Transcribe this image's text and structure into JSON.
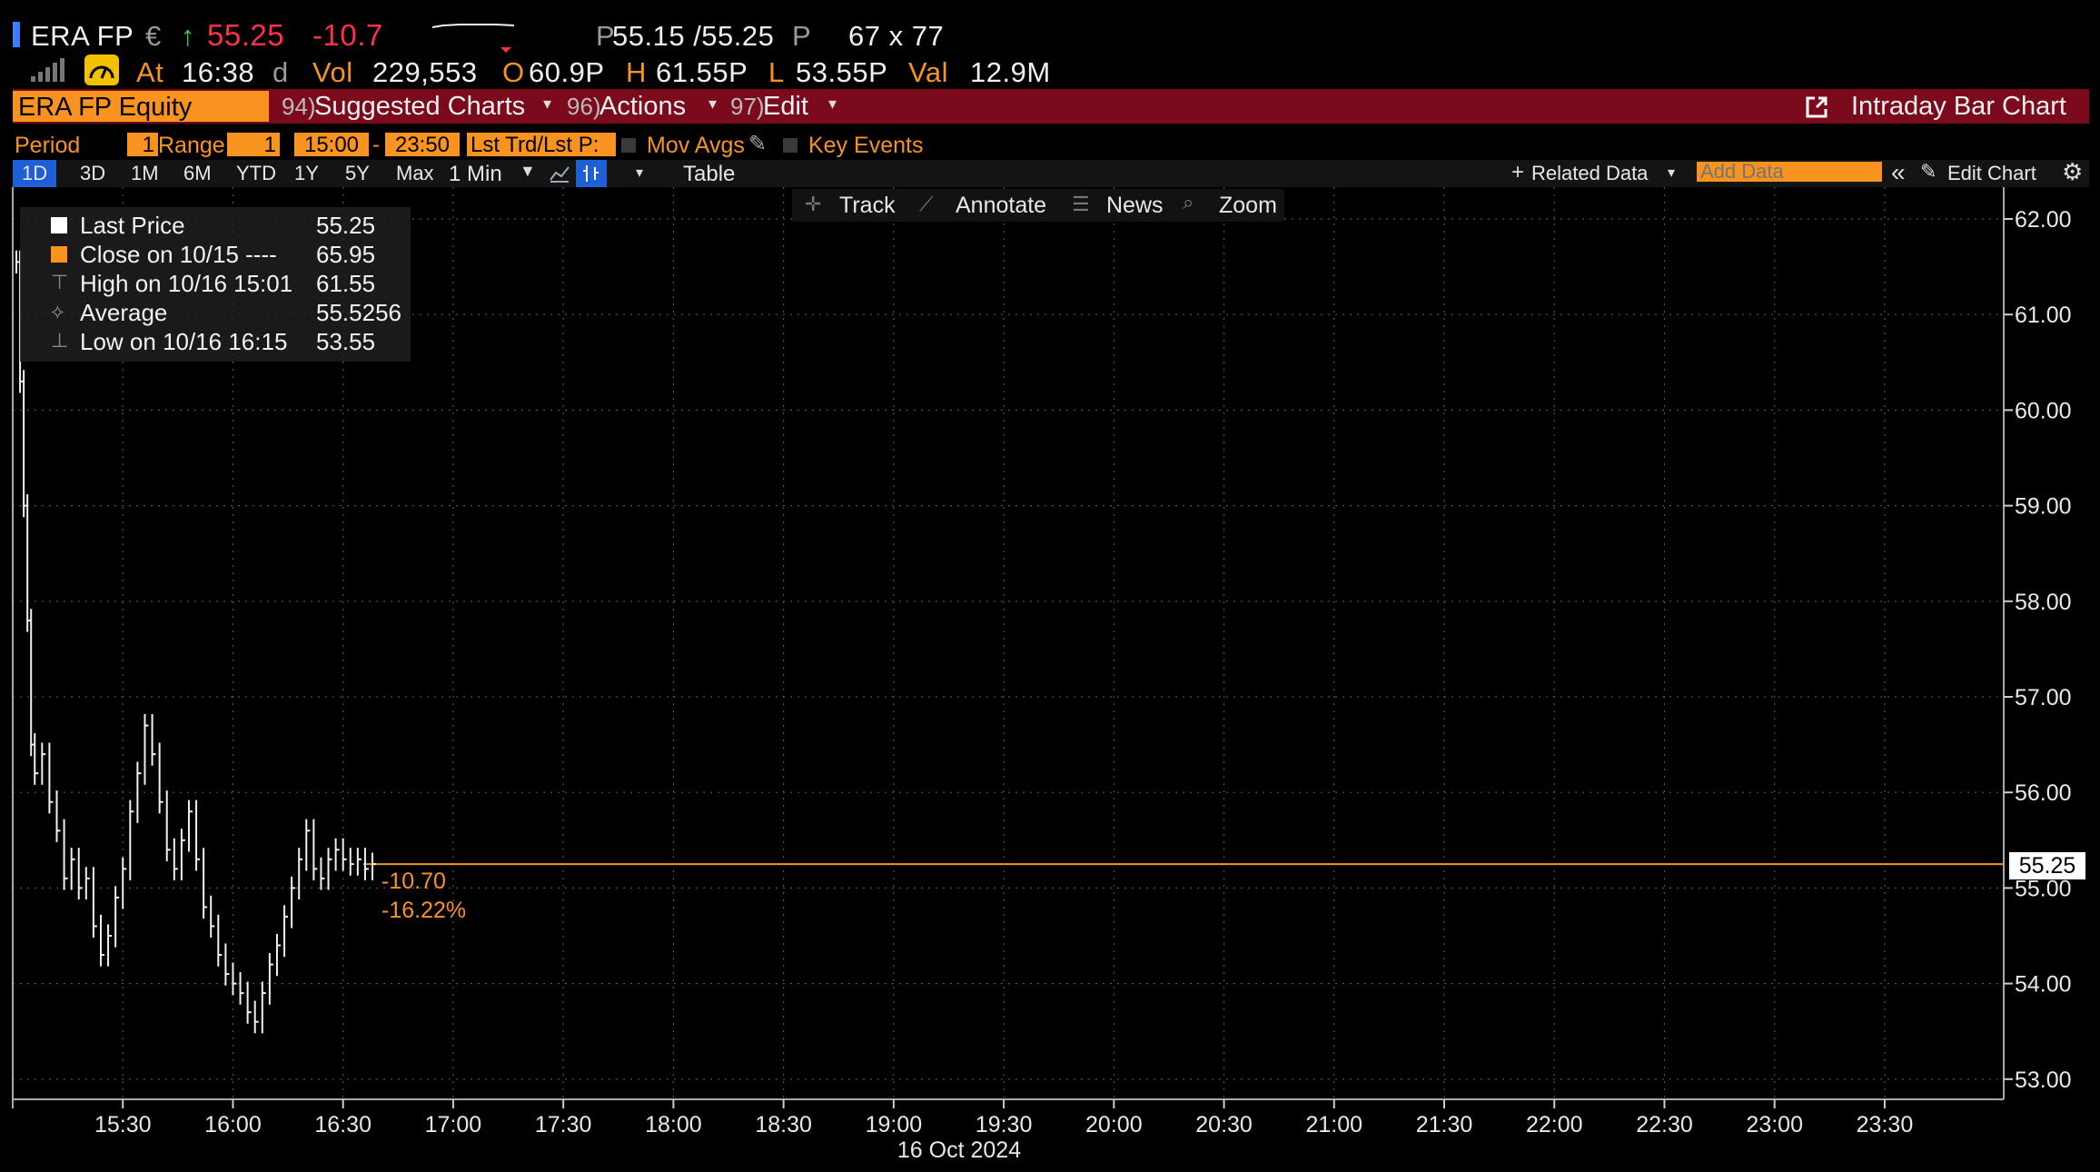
{
  "header": {
    "ticker": "ERA FP",
    "currency": "€",
    "up_arrow": "↑",
    "last_price": "55.25",
    "change": "-10.7",
    "bid_prefix": "P",
    "bid_ask": "55.15 /55.25",
    "ask_suffix": "P",
    "size": "67 x 77",
    "at_label": "At",
    "time": "16:38",
    "time_suffix": "d",
    "vol_label": "Vol",
    "vol": "229,553",
    "open_label": "O",
    "open": "60.9P",
    "high_label": "H",
    "high": "61.55P",
    "low_label": "L",
    "low": "53.55P",
    "val_label": "Val",
    "val": "12.9M"
  },
  "menu_bar": {
    "security": "ERA FP Equity",
    "suggested_num": "94)",
    "suggested": "Suggested Charts",
    "actions_num": "96)",
    "actions": "Actions",
    "edit_num": "97)",
    "edit": "Edit",
    "chart_type": "Intraday Bar Chart"
  },
  "params": {
    "period_label": "Period",
    "period_value": "1",
    "range_label": "Range",
    "range_value": "1",
    "range_start": "15:00",
    "dash": "-",
    "range_end": "23:50",
    "price_type": "Lst Trd/Lst P:",
    "mov_avgs": "Mov Avgs",
    "key_events": "Key Events"
  },
  "toolbar": {
    "ranges": [
      "1D",
      "3D",
      "1M",
      "6M",
      "YTD",
      "1Y",
      "5Y",
      "Max"
    ],
    "active_range": "1D",
    "interval": "1 Min",
    "table": "Table",
    "related_data": "Related Data",
    "add_data_placeholder": "Add Data",
    "edit_chart": "Edit Chart"
  },
  "chart_tools": {
    "track": "Track",
    "annotate": "Annotate",
    "news": "News",
    "zoom": "Zoom"
  },
  "legend": [
    {
      "label": "Last Price",
      "value": "55.25",
      "color": "#ffffff"
    },
    {
      "label": "Close on 10/15 ----",
      "value": "65.95",
      "color": "#f8931f"
    },
    {
      "label": "High on 10/16 15:01",
      "value": "61.55",
      "color": "#cccccc"
    },
    {
      "label": "Average",
      "value": "55.5256",
      "color": "#cccccc"
    },
    {
      "label": "Low on 10/16 16:15",
      "value": "53.55",
      "color": "#cccccc"
    }
  ],
  "annotations": {
    "change": "-10.70",
    "change_pct": "-16.22%",
    "current_price_tag": "55.25"
  },
  "colors": {
    "accent": "#f8931f",
    "menu_red": "#7b0a1d",
    "up_green": "#35d24a",
    "down_red": "#ff3048",
    "active_blue": "#1f5fd6"
  },
  "chart_data": {
    "type": "bar",
    "date_label": "16 Oct 2024",
    "x_ticks": [
      "15:30",
      "16:00",
      "16:30",
      "17:00",
      "17:30",
      "18:00",
      "18:30",
      "19:00",
      "19:30",
      "20:00",
      "20:30",
      "21:00",
      "21:30",
      "22:00",
      "22:30",
      "23:00",
      "23:30"
    ],
    "y_ticks": [
      "62.00",
      "61.00",
      "60.00",
      "59.00",
      "58.00",
      "57.00",
      "56.00",
      "55.00",
      "54.00",
      "53.00"
    ],
    "ylim": [
      52.9,
      62.2
    ],
    "xlim": [
      "15:00",
      "23:50"
    ],
    "reference_line": 55.25,
    "grid": true,
    "series": [
      {
        "name": "Last Price",
        "x": [
          "15:01",
          "15:02",
          "15:03",
          "15:04",
          "15:05",
          "15:06",
          "15:08",
          "15:10",
          "15:12",
          "15:14",
          "15:16",
          "15:18",
          "15:20",
          "15:22",
          "15:24",
          "15:26",
          "15:28",
          "15:30",
          "15:32",
          "15:34",
          "15:36",
          "15:38",
          "15:40",
          "15:42",
          "15:44",
          "15:46",
          "15:48",
          "15:50",
          "15:52",
          "15:54",
          "15:56",
          "15:58",
          "16:00",
          "16:02",
          "16:04",
          "16:06",
          "16:08",
          "16:10",
          "16:12",
          "16:14",
          "16:16",
          "16:18",
          "16:20",
          "16:22",
          "16:24",
          "16:26",
          "16:28",
          "16:30",
          "16:32",
          "16:34",
          "16:36",
          "16:38"
        ],
        "values": [
          61.55,
          60.3,
          59.0,
          57.8,
          56.5,
          56.2,
          56.4,
          55.9,
          55.6,
          55.1,
          55.3,
          55.0,
          55.1,
          54.6,
          54.3,
          54.5,
          54.9,
          55.2,
          55.8,
          56.2,
          56.7,
          56.4,
          55.9,
          55.4,
          55.2,
          55.5,
          55.8,
          55.3,
          54.8,
          54.6,
          54.3,
          54.1,
          54.0,
          53.9,
          53.7,
          53.6,
          53.9,
          54.2,
          54.4,
          54.7,
          55.0,
          55.3,
          55.6,
          55.2,
          55.1,
          55.3,
          55.4,
          55.3,
          55.25,
          55.3,
          55.2,
          55.25
        ]
      }
    ]
  }
}
